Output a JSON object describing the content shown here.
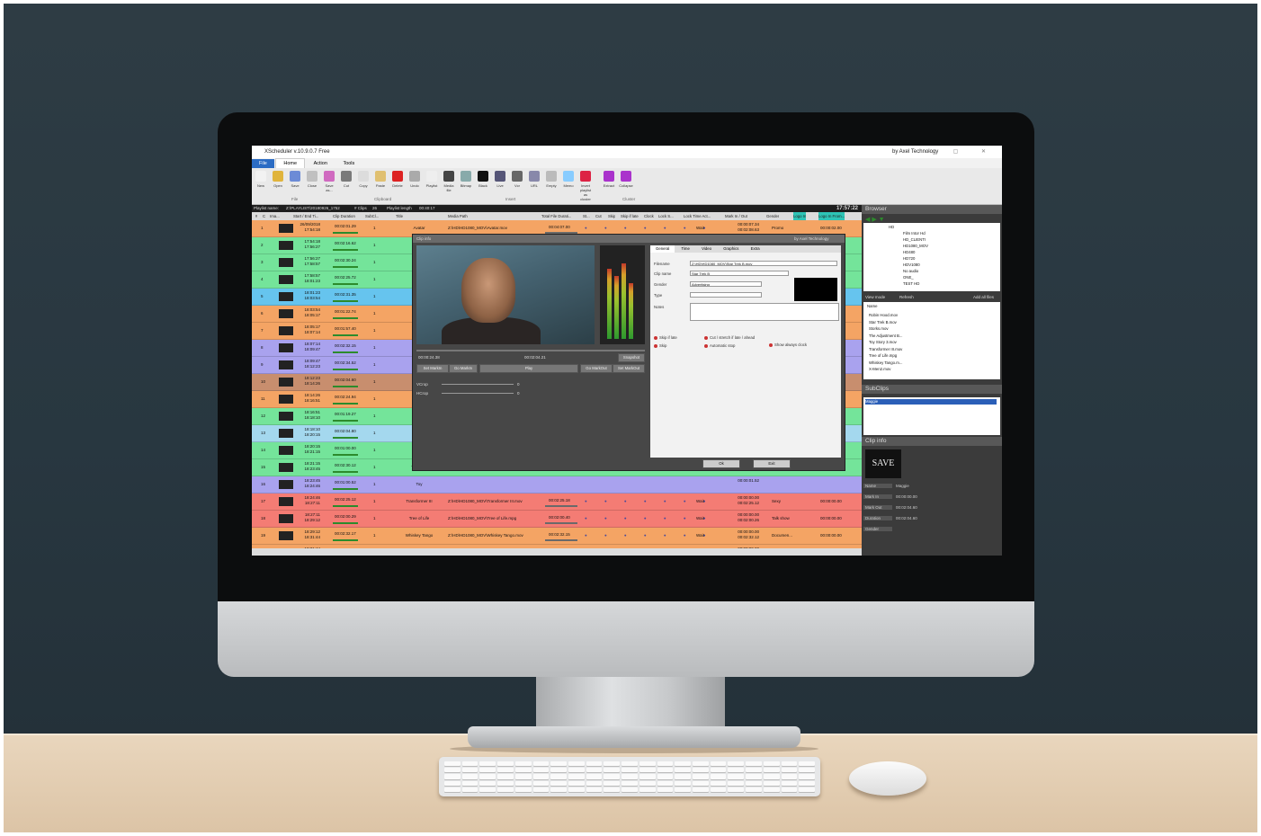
{
  "app": {
    "window_title": "XScheduler v.10.9.0.7 Free",
    "by_line": "by Axel Technology",
    "menu": [
      "File",
      "Home",
      "Action",
      "Tools"
    ],
    "ribbon_buttons": [
      "New",
      "Open",
      "Save",
      "Close",
      "Save as...",
      "Cut",
      "Copy",
      "Paste",
      "Delete",
      "Undo",
      "Playlist",
      "Media file",
      "Bitmap",
      "Black",
      "Live",
      "Vcr",
      "URL",
      "Empty",
      "Memo",
      "Invert playlist as cluster",
      "Extract",
      "Collapse"
    ],
    "ribbon_groups": [
      "File",
      "Clipboard",
      "Insert",
      "Cluster"
    ],
    "playlist_info": {
      "name_label": "Playlist name:",
      "name_value": "Z:\\PLAYLIST\\20180926_1752",
      "clips_label": "# Clips",
      "clips_value": "26",
      "length_label": "Playlist length",
      "length_value": "00:40:17",
      "clock": "17:57:22"
    },
    "columns": [
      "#",
      "C",
      "Ima...",
      "Start / End Ti...",
      "Clip Duration",
      "SubCl...",
      "Title",
      "Media Path",
      "Total File Durati...",
      "St...",
      "Cut",
      "Skip",
      "Skip if late",
      "Clock",
      "Lock S...",
      "Lock Time Act...",
      "Mark In / Out",
      "Gender",
      "Logo In",
      "Logo In From..."
    ],
    "rows": [
      {
        "n": "1",
        "color": "#f4a464",
        "start": "26/09/2018",
        "end": "17:54:18",
        "dur": "00:02:01.29",
        "sub": "1",
        "title": "Avatar",
        "path": "Z:\\HD\\HD1080_MOV\\Avatar.mov",
        "tfd": "00:04:07.00",
        "wait": "Wait",
        "mio": "00:00:07.34",
        "mio2": "00:02:08.63",
        "gen": "Promo",
        "lg": "00:00:02.00"
      },
      {
        "n": "2",
        "color": "#74e49a",
        "start": "17:54:18",
        "end": "17:56:27",
        "dur": "00:02:16.62",
        "sub": "1",
        "title": "Batman",
        "path": "",
        "tfd": "",
        "wait": "",
        "mio": "",
        "mio2": "",
        "gen": "",
        "lg": ""
      },
      {
        "n": "3",
        "color": "#74e49a",
        "start": "17:56:27",
        "end": "17:58:57",
        "dur": "00:02:30.24",
        "sub": "1",
        "title": "Capit",
        "path": "",
        "tfd": "",
        "wait": "",
        "mio": "",
        "mio2": "",
        "gen": "",
        "lg": ""
      },
      {
        "n": "4",
        "color": "#74e49a",
        "start": "17:58:57",
        "end": "18:01:23",
        "dur": "00:02:25.72",
        "sub": "1",
        "title": "Cowbo",
        "path": "",
        "tfd": "",
        "wait": "",
        "mio": "",
        "mio2": "",
        "gen": "",
        "lg": ""
      },
      {
        "n": "5",
        "color": "#66c4ee",
        "start": "18:01:23",
        "end": "18:03:54",
        "dur": "00:02:31.35",
        "sub": "1",
        "title": "De",
        "path": "",
        "tfd": "",
        "wait": "",
        "mio": "",
        "mio2": "",
        "gen": "",
        "lg": ""
      },
      {
        "n": "6",
        "color": "#f4a464",
        "start": "18:03:54",
        "end": "18:05:17",
        "dur": "00:01:22.74",
        "sub": "1",
        "title": "Godz",
        "path": "",
        "tfd": "",
        "wait": "",
        "mio": "",
        "mio2": "",
        "gen": "",
        "lg": ""
      },
      {
        "n": "7",
        "color": "#f4a464",
        "start": "18:05:17",
        "end": "18:07:14",
        "dur": "00:01:57.40",
        "sub": "1",
        "title": "Harr",
        "path": "",
        "tfd": "",
        "wait": "",
        "mio": "",
        "mio2": "",
        "gen": "",
        "lg": ""
      },
      {
        "n": "8",
        "color": "#a9a2ee",
        "start": "18:07:14",
        "end": "18:09:47",
        "dur": "00:02:32.15",
        "sub": "1",
        "title": "London",
        "path": "",
        "tfd": "",
        "wait": "",
        "mio": "",
        "mio2": "",
        "gen": "",
        "lg": ""
      },
      {
        "n": "9",
        "color": "#a9a2ee",
        "start": "18:09:47",
        "end": "18:12:23",
        "dur": "00:02:34.52",
        "sub": "1",
        "title": "M",
        "path": "",
        "tfd": "",
        "wait": "",
        "mio": "",
        "mio2": "",
        "gen": "",
        "lg": ""
      },
      {
        "n": "10",
        "color": "#c88e6e",
        "start": "18:12:23",
        "end": "18:14:26",
        "dur": "00:02:04.60",
        "sub": "1",
        "title": "Sc",
        "path": "",
        "tfd": "",
        "wait": "",
        "mio": "",
        "mio2": "",
        "gen": "",
        "lg": ""
      },
      {
        "n": "11",
        "color": "#f4a464",
        "start": "18:14:26",
        "end": "18:16:51",
        "dur": "00:02:24.94",
        "sub": "1",
        "title": "Sta",
        "path": "",
        "tfd": "",
        "wait": "",
        "mio": "",
        "mio2": "",
        "gen": "",
        "lg": ""
      },
      {
        "n": "12",
        "color": "#74e49a",
        "start": "18:16:51",
        "end": "18:18:10",
        "dur": "00:01:19.27",
        "sub": "1",
        "title": "Rob",
        "path": "",
        "tfd": "",
        "wait": "",
        "mio": "",
        "mio2": "",
        "gen": "",
        "lg": ""
      },
      {
        "n": "13",
        "color": "#a4d8ee",
        "start": "18:18:10",
        "end": "18:20:15",
        "dur": "00:02:04.80",
        "sub": "1",
        "title": "Sta",
        "path": "",
        "tfd": "",
        "wait": "",
        "mio": "",
        "mio2": "",
        "gen": "",
        "lg": ""
      },
      {
        "n": "14",
        "color": "#74e49a",
        "start": "18:20:15",
        "end": "18:21:15",
        "dur": "00:01:00.00",
        "sub": "1",
        "title": "S",
        "path": "",
        "tfd": "",
        "wait": "",
        "mio": "",
        "mio2": "",
        "gen": "",
        "lg": ""
      },
      {
        "n": "15",
        "color": "#74e49a",
        "start": "18:21:15",
        "end": "18:23:45",
        "dur": "00:02:30.12",
        "sub": "1",
        "title": "The Adju",
        "path": "",
        "tfd": "",
        "wait": "",
        "mio": "",
        "mio2": "",
        "gen": "",
        "lg": ""
      },
      {
        "n": "16",
        "color": "#a9a2ee",
        "start": "18:23:45",
        "end": "18:24:46",
        "dur": "00:01:00.52",
        "sub": "1",
        "title": "Toy",
        "path": "",
        "tfd": "",
        "wait": "",
        "mio": "00:00:01.52",
        "mio2": "",
        "gen": "",
        "lg": ""
      },
      {
        "n": "17",
        "color": "#f47c74",
        "start": "18:24:46",
        "end": "18:27:11",
        "dur": "00:02:25.12",
        "sub": "1",
        "title": "Transformer III",
        "path": "Z:\\HD\\HD1080_MOV\\Transformer III.mov",
        "tfd": "00:02:25.18",
        "wait": "Wait",
        "mio": "00:00:00.00",
        "mio2": "00:02:25.12",
        "gen": "Sexy",
        "lg": "00:00:00.00"
      },
      {
        "n": "18",
        "color": "#f47c74",
        "start": "18:27:11",
        "end": "18:29:12",
        "dur": "00:02:00.29",
        "sub": "1",
        "title": "Tree of Life",
        "path": "Z:\\HD\\HD1080_MOV\\Tree of Life.mpg",
        "tfd": "00:02:00.40",
        "wait": "Wait",
        "mio": "00:00:00.00",
        "mio2": "00:02:00.26",
        "gen": "Talk show",
        "lg": "00:00:00.00"
      },
      {
        "n": "19",
        "color": "#f4a464",
        "start": "18:29:12",
        "end": "18:31:44",
        "dur": "00:02:32.17",
        "sub": "1",
        "title": "Whiskey Tango",
        "path": "Z:\\HD\\HD1080_MOV\\Whiskey Tango.mov",
        "tfd": "00:02:32.15",
        "wait": "Wait",
        "mio": "00:00:00.00",
        "mio2": "00:02:32.12",
        "gen": "Documen...",
        "lg": "00:00:00.00"
      },
      {
        "n": "20",
        "color": "#f4a464",
        "start": "18:31:44",
        "end": "18:34:26",
        "dur": "00:02:42.60",
        "sub": "1",
        "title": "X-Men2",
        "path": "Z:\\HD\\HD1080_MOV\\X-Men2.mov",
        "tfd": "00:02:42.74",
        "wait": "Wait",
        "mio": "00:00:00.00",
        "mio2": "00:02:42.60",
        "gen": "Documen...",
        "lg": "00:00:00.00"
      }
    ]
  },
  "clip_dialog": {
    "caption": "Clip info",
    "by_line": "by Axel Technology",
    "tc_in": "00:00:24.38",
    "tc_out": "00:02:04.21",
    "snapshot": "Snapshot",
    "set_markin": "Set MarkIn",
    "go_markin": "Go MarkIn",
    "play": "Play",
    "go_markout": "Go MarkOut",
    "set_markout": "Set MarkOut",
    "vcrop": "VCrop",
    "hcrop": "HCrop",
    "vcrop_val": "0",
    "hcrop_val": "0",
    "tabs": [
      "General",
      "Time",
      "Video",
      "Graphics",
      "Extra"
    ],
    "filename_label": "Filename",
    "filename": "Z:\\HD\\HD1080_MOV\\Star Trek B.mov",
    "clipname_label": "Clip name",
    "clipname": "Star Trek B",
    "gender_label": "Gender",
    "gender": "Advertising",
    "type_label": "Type",
    "type": "",
    "notes_label": "Notes",
    "skip_if_late": "Skip if late",
    "skip": "Skip",
    "cut_stretch": "Cut / stretch if late / ahead",
    "automatic_stop": "Automatic stop",
    "show_clock": "Show always clock",
    "ok": "Ok",
    "exit": "Exit"
  },
  "browser": {
    "title": "Browser",
    "tree": [
      "HD",
      "Film Intor Hd",
      "HD_CLIENTI",
      "HD1080_MOV",
      "HD480",
      "HD720",
      "HDV1080",
      "No audio",
      "ONE_",
      "TEST HD"
    ],
    "view_mode": "View mode",
    "refresh": "Refresh",
    "add_all": "Add all files",
    "list_header": "Name",
    "files": [
      "Robin Hood.mov",
      "Star Trek B.mov",
      "Storks.mov",
      "The Adjustment B...",
      "Toy Story 3.mov",
      "Transformer III.mov",
      "Tree of Life.mpg",
      "Whiskey Tango.m...",
      "X-Men2.mov"
    ]
  },
  "subclips": {
    "title": "SubClips",
    "selected": "Maggie"
  },
  "clip_info": {
    "title": "Clip info",
    "poster_text": "SAVE",
    "fields": [
      {
        "k": "Name",
        "v": "Maggie"
      },
      {
        "k": "Mark In",
        "v": "00:00:00.00"
      },
      {
        "k": "Mark Out",
        "v": "00:02:04.60"
      },
      {
        "k": "Duration",
        "v": "00:02:04.60"
      },
      {
        "k": "Gender",
        "v": ""
      }
    ]
  }
}
